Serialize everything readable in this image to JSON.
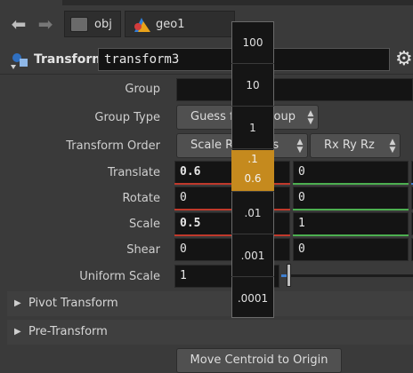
{
  "path": {
    "back_icon": "arrow-left-icon",
    "forward_icon": "arrow-right-icon",
    "segments": [
      {
        "label": "obj",
        "icon": "obj-network-icon"
      },
      {
        "label": "geo1",
        "icon": "geo-node-icon"
      }
    ]
  },
  "node": {
    "type_label": "Transform",
    "name": "transform3",
    "gear_icon": "gear-icon"
  },
  "parms": {
    "group": {
      "label": "Group",
      "value": ""
    },
    "group_type": {
      "label": "Group Type",
      "value": "Guess from Group"
    },
    "transform_order": {
      "label": "Transform Order",
      "value": "Scale Rot Trans",
      "rot_value": "Rx Ry Rz"
    },
    "translate": {
      "label": "Translate",
      "x": "0.6",
      "y": "0"
    },
    "rotate": {
      "label": "Rotate",
      "x": "0",
      "y": "0"
    },
    "scale": {
      "label": "Scale",
      "x": "0.5",
      "y": "1"
    },
    "shear": {
      "label": "Shear",
      "x": "0",
      "y": "0"
    },
    "uniform_scale": {
      "label": "Uniform Scale",
      "value": "1"
    }
  },
  "sections": {
    "pivot": "Pivot Transform",
    "pre": "Pre-Transform"
  },
  "buttons": {
    "move_centroid": "Move Centroid to Origin"
  },
  "ladder": {
    "steps": [
      "100",
      "10",
      "1",
      ".1",
      ".01",
      ".001",
      ".0001"
    ],
    "active_step": ".1",
    "active_value": "0.6"
  },
  "colors": {
    "ladder_active": "#c58a1e",
    "x_axis": "#c0392b",
    "y_axis": "#4caf50",
    "z_axis": "#3f7fd0"
  }
}
